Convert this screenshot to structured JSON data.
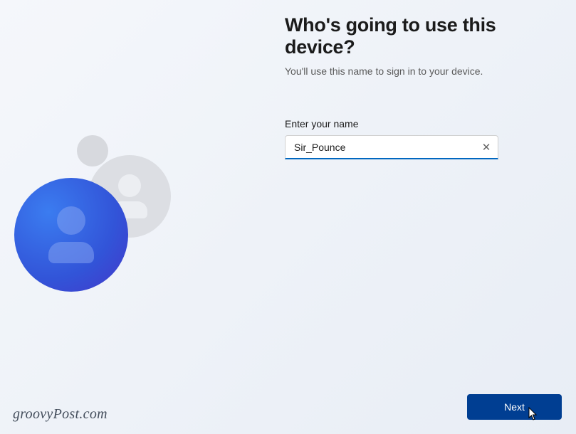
{
  "heading": "Who's going to use this device?",
  "subheading": "You'll use this name to sign in to your device.",
  "field_label": "Enter your name",
  "input_value": "Sir_Pounce",
  "next_button_label": "Next",
  "watermark": "groovyPost.com",
  "colors": {
    "accent": "#0067c0",
    "next_button": "#003e92"
  }
}
